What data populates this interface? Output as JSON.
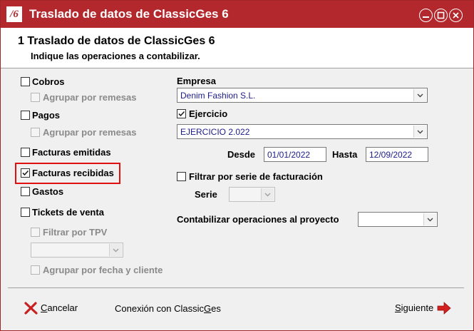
{
  "window": {
    "title": "Traslado de datos de ClassicGes 6",
    "app_icon_text": "/6",
    "controls": [
      "minimize-icon",
      "maximize-icon",
      "close-icon"
    ]
  },
  "header": {
    "step_title": "1  Traslado de datos de ClassicGes 6",
    "subtitle": "Indique las operaciones a contabilizar."
  },
  "left": {
    "cobros": {
      "label": "Cobros",
      "checked": false
    },
    "cobros_agrupar": {
      "label": "Agrupar por remesas",
      "checked": false,
      "enabled": false
    },
    "pagos": {
      "label": "Pagos",
      "checked": false
    },
    "pagos_agrupar": {
      "label": "Agrupar por remesas",
      "checked": false,
      "enabled": false
    },
    "facturas_emitidas": {
      "label": "Facturas emitidas",
      "checked": false
    },
    "facturas_recibidas": {
      "label": "Facturas recibidas",
      "checked": true
    },
    "gastos": {
      "label": "Gastos",
      "checked": false
    },
    "tickets": {
      "label": "Tickets de venta",
      "checked": false
    },
    "filtrar_tpv": {
      "label": "Filtrar por TPV",
      "checked": false,
      "enabled": false
    },
    "tpv_select": {
      "value": ""
    },
    "agrupar_fecha": {
      "label": "Agrupar por fecha y cliente",
      "checked": false,
      "enabled": false
    }
  },
  "right": {
    "empresa_label": "Empresa",
    "empresa_value": "Denim Fashion S.L.",
    "ejercicio": {
      "label": "Ejercicio",
      "checked": true
    },
    "ejercicio_value": "EJERCICIO 2.022",
    "desde_label": "Desde",
    "desde_value": "01/01/2022",
    "hasta_label": "Hasta",
    "hasta_value": "12/09/2022",
    "filtrar_serie": {
      "label": "Filtrar por serie de facturación",
      "checked": false
    },
    "serie_label": "Serie",
    "serie_value": "",
    "proyecto_label": "Contabilizar operaciones al proyecto",
    "proyecto_value": ""
  },
  "footer": {
    "cancel": {
      "prefix": "",
      "underlined": "C",
      "rest": "ancelar"
    },
    "connection": {
      "prefix": "Conexión con Classic",
      "underlined": "G",
      "rest": "es"
    },
    "next": {
      "prefix": "",
      "underlined": "S",
      "rest": "iguiente"
    }
  },
  "colors": {
    "titlebar": "#b3282d",
    "highlight": "#e01010",
    "value_text": "#1c1c8a"
  }
}
